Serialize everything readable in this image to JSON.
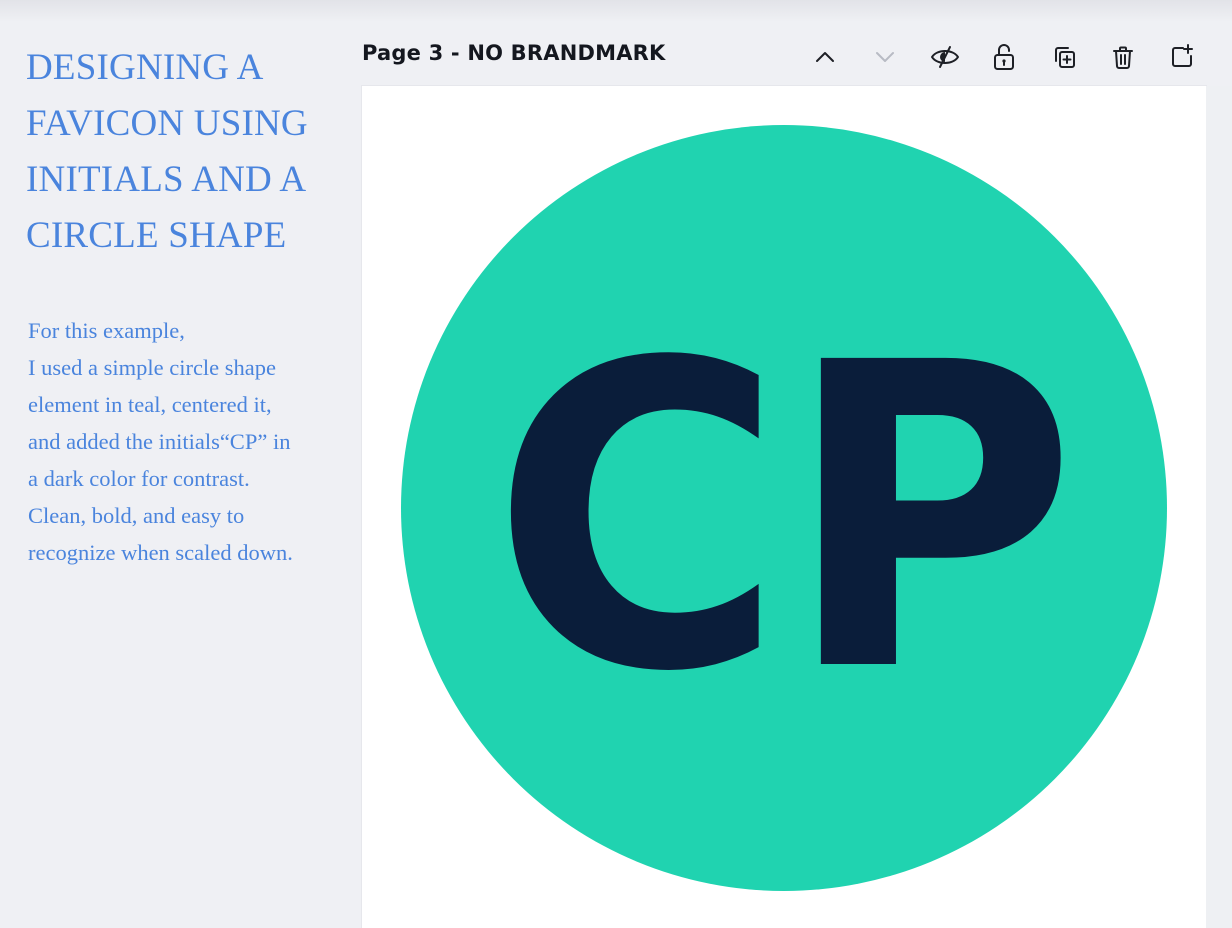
{
  "annotation": {
    "title_lines": [
      "DESIGNING A",
      "FAVICON USING",
      "INITIALS AND A",
      "CIRCLE SHAPE"
    ],
    "body_lines": [
      "For this example,",
      "I used a simple circle shape",
      "element in teal, centered it,",
      "and added the initials“CP” in",
      "a dark color for contrast.",
      "Clean, bold, and easy to",
      "recognize when scaled down."
    ]
  },
  "toolbar": {
    "page_label": "Page 3 - NO BRANDMARK",
    "icons": [
      "chevron-up-icon",
      "chevron-down-icon",
      "eye-hide-icon",
      "unlock-icon",
      "duplicate-icon",
      "trash-icon",
      "add-page-icon"
    ]
  },
  "canvas": {
    "logo": {
      "initials": "CP",
      "circle_color": "#20d3b0",
      "letter_color": "#0a1d3a"
    }
  }
}
